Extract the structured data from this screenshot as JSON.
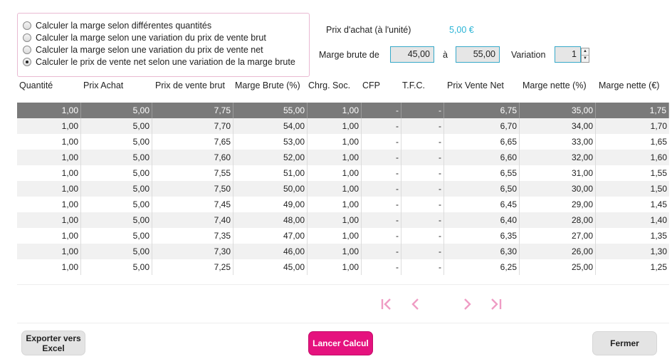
{
  "options": [
    {
      "label": "Calculer la marge selon différentes quantités",
      "checked": false
    },
    {
      "label": "Calculer la marge selon une variation du prix de vente brut",
      "checked": false
    },
    {
      "label": "Calculer la marge selon une variation du prix de vente net",
      "checked": false
    },
    {
      "label": "Calculer le prix de vente net selon une variation de la marge brute",
      "checked": true
    }
  ],
  "params": {
    "purchase_price_label": "Prix d'achat (à l'unité)",
    "purchase_price_value": "5,00 €",
    "margin_from_label": "Marge brute de",
    "margin_from_value": "45,00",
    "margin_to_label": "à",
    "margin_to_value": "55,00",
    "variation_label": "Variation",
    "variation_value": "1"
  },
  "table": {
    "headers": [
      "Quantité",
      "Prix Achat",
      "Prix de vente brut",
      "Marge Brute (%)",
      "Chrg. Soc.",
      "CFP",
      "T.F.C.",
      "Prix Vente Net",
      "Marge nette (%)",
      "Marge nette (€)"
    ],
    "rows": [
      [
        "1,00",
        "5,00",
        "7,75",
        "55,00",
        "1,00",
        "-",
        "-",
        "6,75",
        "35,00",
        "1,75"
      ],
      [
        "1,00",
        "5,00",
        "7,70",
        "54,00",
        "1,00",
        "-",
        "-",
        "6,70",
        "34,00",
        "1,70"
      ],
      [
        "1,00",
        "5,00",
        "7,65",
        "53,00",
        "1,00",
        "-",
        "-",
        "6,65",
        "33,00",
        "1,65"
      ],
      [
        "1,00",
        "5,00",
        "7,60",
        "52,00",
        "1,00",
        "-",
        "-",
        "6,60",
        "32,00",
        "1,60"
      ],
      [
        "1,00",
        "5,00",
        "7,55",
        "51,00",
        "1,00",
        "-",
        "-",
        "6,55",
        "31,00",
        "1,55"
      ],
      [
        "1,00",
        "5,00",
        "7,50",
        "50,00",
        "1,00",
        "-",
        "-",
        "6,50",
        "30,00",
        "1,50"
      ],
      [
        "1,00",
        "5,00",
        "7,45",
        "49,00",
        "1,00",
        "-",
        "-",
        "6,45",
        "29,00",
        "1,45"
      ],
      [
        "1,00",
        "5,00",
        "7,40",
        "48,00",
        "1,00",
        "-",
        "-",
        "6,40",
        "28,00",
        "1,40"
      ],
      [
        "1,00",
        "5,00",
        "7,35",
        "47,00",
        "1,00",
        "-",
        "-",
        "6,35",
        "27,00",
        "1,35"
      ],
      [
        "1,00",
        "5,00",
        "7,30",
        "46,00",
        "1,00",
        "-",
        "-",
        "6,30",
        "26,00",
        "1,30"
      ],
      [
        "1,00",
        "5,00",
        "7,25",
        "45,00",
        "1,00",
        "-",
        "-",
        "6,25",
        "25,00",
        "1,25"
      ]
    ]
  },
  "pager": {
    "first_icon": "first-page-icon",
    "prev_icon": "previous-page-icon",
    "next_icon": "next-page-icon",
    "last_icon": "last-page-icon"
  },
  "buttons": {
    "export_line1": "Exporter vers",
    "export_line2": "Excel",
    "calculate": "Lancer Calcul",
    "close": "Fermer"
  },
  "colors": {
    "accent": "#e5127e",
    "price": "#2ab4d6",
    "field_border": "#36a9c9",
    "selected_row": "#7a7a7a",
    "pager": "#ef9cc4"
  }
}
